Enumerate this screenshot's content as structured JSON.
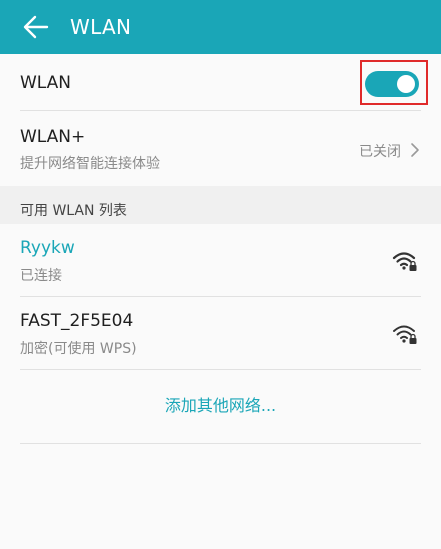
{
  "app_bar": {
    "title": "WLAN",
    "icon": "back-arrow-icon",
    "background_color": "#1aa6b7"
  },
  "wlan_toggle": {
    "label": "WLAN",
    "state": "on",
    "accent_color": "#1aa6b7",
    "highlight_color": "#e02a2a"
  },
  "wlan_plus": {
    "title": "WLAN+",
    "subtitle": "提升网络智能连接体验",
    "status": "已关闭",
    "icon": "chevron-right-icon"
  },
  "available_section": {
    "header": "可用 WLAN 列表"
  },
  "networks": [
    {
      "ssid": "Ryykw",
      "status": "已连接",
      "connected": true,
      "icon": "wifi-lock-icon"
    },
    {
      "ssid": "FAST_2F5E04",
      "status": "加密(可使用 WPS)",
      "connected": false,
      "icon": "wifi-lock-icon"
    }
  ],
  "add_network": {
    "label": "添加其他网络..."
  }
}
